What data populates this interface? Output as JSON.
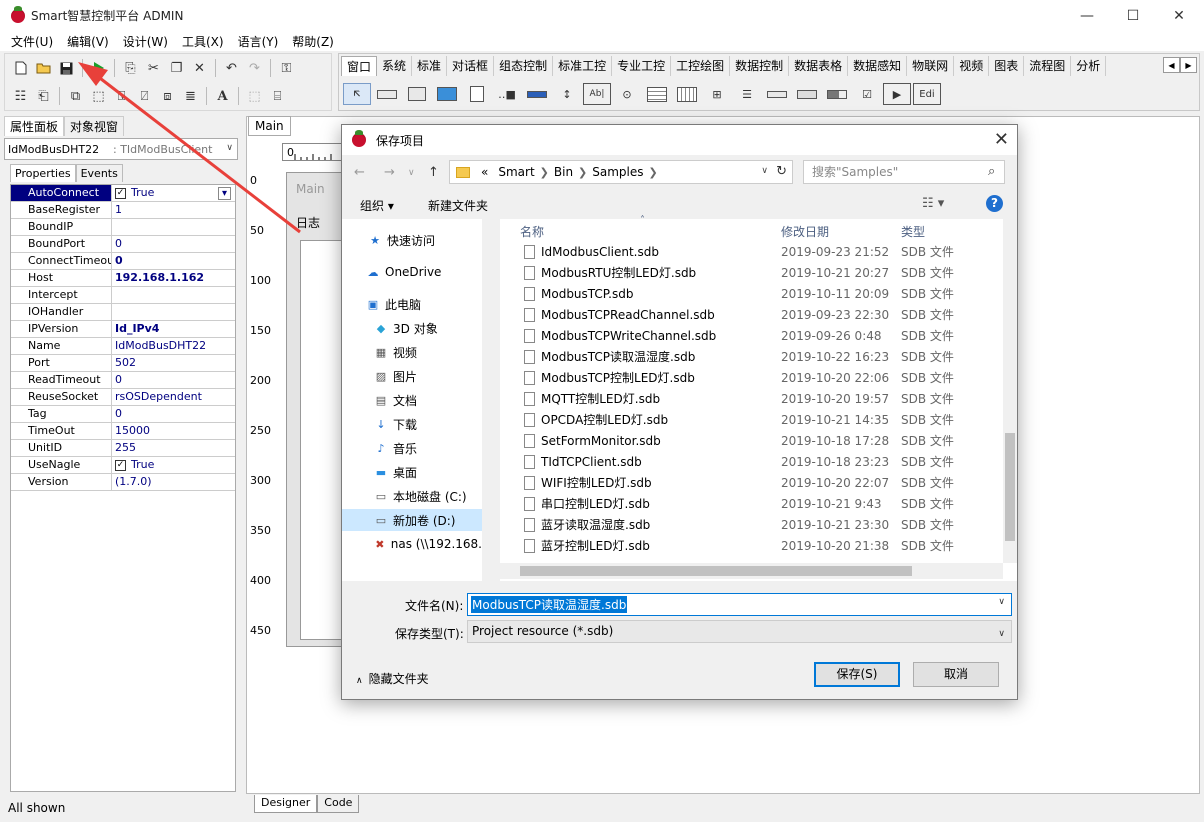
{
  "window": {
    "title": "Smart智慧控制平台 ADMIN"
  },
  "menu": [
    "文件(U)",
    "编辑(V)",
    "设计(W)",
    "工具(X)",
    "语言(Y)",
    "帮助(Z)"
  ],
  "palette": {
    "tabs": [
      "窗口",
      "系统",
      "标准",
      "对话框",
      "组态控制",
      "标准工控",
      "专业工控",
      "工控绘图",
      "数据控制",
      "数据表格",
      "数据感知",
      "物联网",
      "视频",
      "图表",
      "流程图",
      "分析"
    ],
    "edit_label": "Edi"
  },
  "left_panel": {
    "tabs": [
      "属性面板",
      "对象视窗"
    ],
    "component_name": "IdModBusDHT22",
    "component_type": ": TIdModBusClient",
    "inspector_tabs": [
      "Properties",
      "Events"
    ],
    "properties": [
      {
        "name": "AutoConnect",
        "value": "True",
        "checkbox": true,
        "selected": true
      },
      {
        "name": "BaseRegister",
        "value": "1"
      },
      {
        "name": "BoundIP",
        "value": ""
      },
      {
        "name": "BoundPort",
        "value": "0"
      },
      {
        "name": "ConnectTimeout",
        "value": "0",
        "bold": true
      },
      {
        "name": "Host",
        "value": "192.168.1.162",
        "bold": true
      },
      {
        "name": "Intercept",
        "value": ""
      },
      {
        "name": "IOHandler",
        "value": ""
      },
      {
        "name": "IPVersion",
        "value": "Id_IPv4",
        "bold": true
      },
      {
        "name": "Name",
        "value": "IdModBusDHT22"
      },
      {
        "name": "Port",
        "value": "502"
      },
      {
        "name": "ReadTimeout",
        "value": "0"
      },
      {
        "name": "ReuseSocket",
        "value": "rsOSDependent"
      },
      {
        "name": "Tag",
        "value": "0"
      },
      {
        "name": "TimeOut",
        "value": "15000"
      },
      {
        "name": "UnitID",
        "value": "255"
      },
      {
        "name": "UseNagle",
        "value": "True",
        "checkbox": true
      },
      {
        "name": "Version",
        "value": "(1.7.0)"
      }
    ],
    "status": "All shown"
  },
  "designer": {
    "tab": "Main",
    "ruler_labels": [
      "0",
      "50",
      "100",
      "150",
      "200",
      "250",
      "300",
      "350",
      "400",
      "450"
    ],
    "form_caption": "Main",
    "form_label": "日志",
    "bottom_tabs": [
      "Designer",
      "Code"
    ]
  },
  "dialog": {
    "title": "保存项目",
    "breadcrumb": [
      "Smart",
      "Bin",
      "Samples"
    ],
    "breadcrumb_prefix": "«",
    "search_placeholder": "搜索\"Samples\"",
    "organize": "组织 ▾",
    "new_folder": "新建文件夹",
    "nav": [
      {
        "label": "快速访问",
        "icon": "star-icon"
      },
      {
        "label": "OneDrive",
        "icon": "cloud-icon"
      },
      {
        "label": "此电脑",
        "icon": "computer-icon"
      },
      {
        "label": "3D 对象",
        "icon": "cube-icon"
      },
      {
        "label": "视频",
        "icon": "film-icon"
      },
      {
        "label": "图片",
        "icon": "picture-icon"
      },
      {
        "label": "文档",
        "icon": "document-icon"
      },
      {
        "label": "下载",
        "icon": "download-icon"
      },
      {
        "label": "音乐",
        "icon": "music-icon"
      },
      {
        "label": "桌面",
        "icon": "desktop-icon"
      },
      {
        "label": "本地磁盘 (C:)",
        "icon": "drive-icon"
      },
      {
        "label": "新加卷 (D:)",
        "icon": "drive-icon",
        "selected": true
      },
      {
        "label": "nas (\\\\192.168.",
        "icon": "network-drive-icon"
      }
    ],
    "columns": {
      "name": "名称",
      "date": "修改日期",
      "type": "类型"
    },
    "files": [
      {
        "name": "IdModbusClient.sdb",
        "date": "2019-09-23 21:52",
        "type": "SDB 文件"
      },
      {
        "name": "ModbusRTU控制LED灯.sdb",
        "date": "2019-10-21 20:27",
        "type": "SDB 文件"
      },
      {
        "name": "ModbusTCP.sdb",
        "date": "2019-10-11 20:09",
        "type": "SDB 文件"
      },
      {
        "name": "ModbusTCPReadChannel.sdb",
        "date": "2019-09-23 22:30",
        "type": "SDB 文件"
      },
      {
        "name": "ModbusTCPWriteChannel.sdb",
        "date": "2019-09-26 0:48",
        "type": "SDB 文件"
      },
      {
        "name": "ModbusTCP读取温湿度.sdb",
        "date": "2019-10-22 16:23",
        "type": "SDB 文件"
      },
      {
        "name": "ModbusTCP控制LED灯.sdb",
        "date": "2019-10-20 22:06",
        "type": "SDB 文件"
      },
      {
        "name": "MQTT控制LED灯.sdb",
        "date": "2019-10-20 19:57",
        "type": "SDB 文件"
      },
      {
        "name": "OPCDA控制LED灯.sdb",
        "date": "2019-10-21 14:35",
        "type": "SDB 文件"
      },
      {
        "name": "SetFormMonitor.sdb",
        "date": "2019-10-18 17:28",
        "type": "SDB 文件"
      },
      {
        "name": "TIdTCPClient.sdb",
        "date": "2019-10-18 23:23",
        "type": "SDB 文件"
      },
      {
        "name": "WIFI控制LED灯.sdb",
        "date": "2019-10-20 22:07",
        "type": "SDB 文件"
      },
      {
        "name": "串口控制LED灯.sdb",
        "date": "2019-10-21 9:43",
        "type": "SDB 文件"
      },
      {
        "name": "蓝牙读取温湿度.sdb",
        "date": "2019-10-21 23:30",
        "type": "SDB 文件"
      },
      {
        "name": "蓝牙控制LED灯.sdb",
        "date": "2019-10-20 21:38",
        "type": "SDB 文件"
      }
    ],
    "filename_label": "文件名(N):",
    "filename_value": "ModbusTCP读取温湿度.sdb",
    "filetype_label": "保存类型(T):",
    "filetype_value": "Project resource (*.sdb)",
    "hide_folders": "隐藏文件夹",
    "save": "保存(S)",
    "cancel": "取消"
  },
  "annotation": {
    "arrow_color": "#e8403a"
  }
}
